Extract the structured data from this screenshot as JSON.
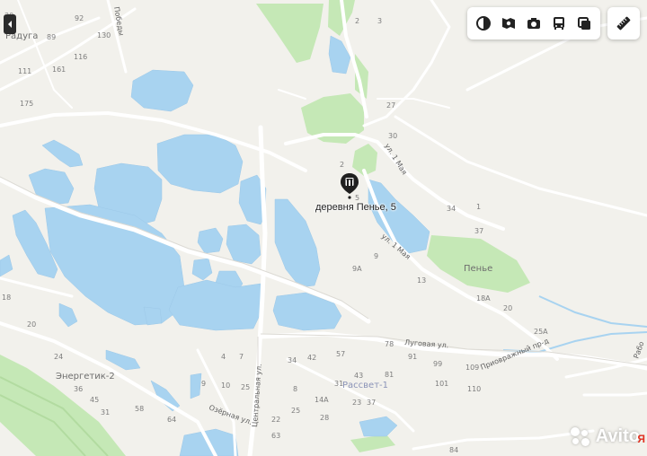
{
  "map": {
    "pin_label": "деревня Пенье, 5",
    "places": {
      "raduga": "Радуга",
      "penye": "Пенье",
      "rassvet": "Рассвет-1",
      "energetik": "Энергетик-2"
    },
    "streets": {
      "pobedy": "Победы",
      "may1_north": "ул. 1 Мая",
      "may1_south": "ул. 1 Мая",
      "lugovaya": "Луговая ул.",
      "privrazhny": "Приовражный пр-д",
      "centralnaya": "Центральная ул.",
      "ozernaya": "Озёрная ул.",
      "rabochaya": "Рабо"
    },
    "house_numbers": [
      "92",
      "89",
      "30",
      "116",
      "130",
      "111",
      "161",
      "175",
      "2",
      "3",
      "27",
      "30",
      "2",
      "5",
      "34",
      "1",
      "37",
      "9",
      "9А",
      "13",
      "18А",
      "20",
      "25А",
      "18",
      "20",
      "24",
      "36",
      "45",
      "31",
      "64",
      "58",
      "78",
      "42",
      "34",
      "57",
      "81",
      "91",
      "99",
      "109",
      "110",
      "101",
      "9",
      "10",
      "7",
      "4",
      "8",
      "22",
      "25",
      "28",
      "23",
      "37",
      "84",
      "14А",
      "31",
      "43",
      "63",
      "25",
      "8"
    ],
    "colors": {
      "land": "#f2f1ec",
      "water": "#a8d3f0",
      "park": "#c5e8b6",
      "road": "#ffffff",
      "pin": "#1f1f1f"
    }
  },
  "toolbar": {
    "layers_icon": "layers-icon",
    "panorama_icon": "panorama-icon",
    "photo_icon": "camera-icon",
    "transit_icon": "bus-icon",
    "traffic_icon": "traffic-icon",
    "ruler_icon": "ruler-icon"
  },
  "watermark": {
    "text": "Avito",
    "yandex": "Я"
  }
}
